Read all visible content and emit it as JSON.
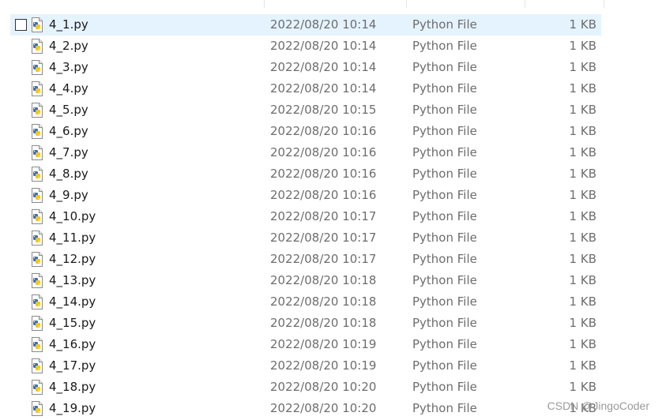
{
  "files": [
    {
      "name": "4_1.py",
      "date_modified": "2022/08/20 10:14",
      "type": "Python File",
      "size": "1 KB"
    },
    {
      "name": "4_2.py",
      "date_modified": "2022/08/20 10:14",
      "type": "Python File",
      "size": "1 KB"
    },
    {
      "name": "4_3.py",
      "date_modified": "2022/08/20 10:14",
      "type": "Python File",
      "size": "1 KB"
    },
    {
      "name": "4_4.py",
      "date_modified": "2022/08/20 10:14",
      "type": "Python File",
      "size": "1 KB"
    },
    {
      "name": "4_5.py",
      "date_modified": "2022/08/20 10:15",
      "type": "Python File",
      "size": "1 KB"
    },
    {
      "name": "4_6.py",
      "date_modified": "2022/08/20 10:16",
      "type": "Python File",
      "size": "1 KB"
    },
    {
      "name": "4_7.py",
      "date_modified": "2022/08/20 10:16",
      "type": "Python File",
      "size": "1 KB"
    },
    {
      "name": "4_8.py",
      "date_modified": "2022/08/20 10:16",
      "type": "Python File",
      "size": "1 KB"
    },
    {
      "name": "4_9.py",
      "date_modified": "2022/08/20 10:16",
      "type": "Python File",
      "size": "1 KB"
    },
    {
      "name": "4_10.py",
      "date_modified": "2022/08/20 10:17",
      "type": "Python File",
      "size": "1 KB"
    },
    {
      "name": "4_11.py",
      "date_modified": "2022/08/20 10:17",
      "type": "Python File",
      "size": "1 KB"
    },
    {
      "name": "4_12.py",
      "date_modified": "2022/08/20 10:17",
      "type": "Python File",
      "size": "1 KB"
    },
    {
      "name": "4_13.py",
      "date_modified": "2022/08/20 10:18",
      "type": "Python File",
      "size": "1 KB"
    },
    {
      "name": "4_14.py",
      "date_modified": "2022/08/20 10:18",
      "type": "Python File",
      "size": "1 KB"
    },
    {
      "name": "4_15.py",
      "date_modified": "2022/08/20 10:18",
      "type": "Python File",
      "size": "1 KB"
    },
    {
      "name": "4_16.py",
      "date_modified": "2022/08/20 10:19",
      "type": "Python File",
      "size": "1 KB"
    },
    {
      "name": "4_17.py",
      "date_modified": "2022/08/20 10:19",
      "type": "Python File",
      "size": "1 KB"
    },
    {
      "name": "4_18.py",
      "date_modified": "2022/08/20 10:20",
      "type": "Python File",
      "size": "1 KB"
    },
    {
      "name": "4_19.py",
      "date_modified": "2022/08/20 10:20",
      "type": "Python File",
      "size": "1 KB"
    }
  ],
  "selected_index": 0,
  "file_icon": "python-file-icon",
  "watermark": "CSDN @JingoCoder",
  "colors": {
    "selection_bg": "#e5f3ff",
    "python_blue": "#3a6fb0",
    "python_yellow": "#f5c518",
    "secondary_text": "#6d6d6d"
  }
}
